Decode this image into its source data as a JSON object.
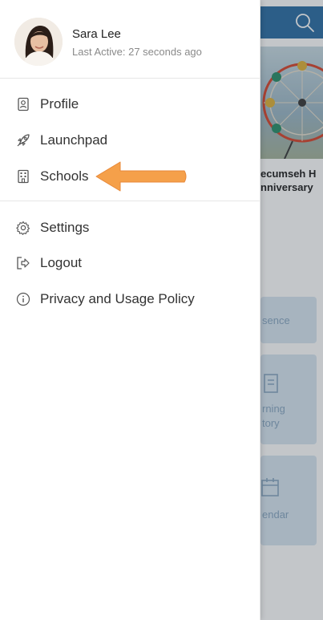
{
  "user": {
    "name": "Sara Lee",
    "last_active": "Last Active: 27 seconds ago"
  },
  "menu": {
    "primary": [
      {
        "label": "Profile",
        "icon": "profile-icon"
      },
      {
        "label": "Launchpad",
        "icon": "rocket-icon"
      },
      {
        "label": "Schools",
        "icon": "building-icon"
      }
    ],
    "secondary": [
      {
        "label": "Settings",
        "icon": "gear-icon"
      },
      {
        "label": "Logout",
        "icon": "logout-icon"
      },
      {
        "label": "Privacy and Usage Policy",
        "icon": "info-icon"
      }
    ]
  },
  "background": {
    "news_title_line1": "ecumseh H",
    "news_title_line2": "nniversary",
    "tiles": [
      "sence",
      "rning",
      "tory",
      "endar"
    ]
  },
  "colors": {
    "topbar": "#2f6fa6",
    "highlight_arrow": "#f5a04a",
    "tile_bg": "#d8e6f2"
  }
}
